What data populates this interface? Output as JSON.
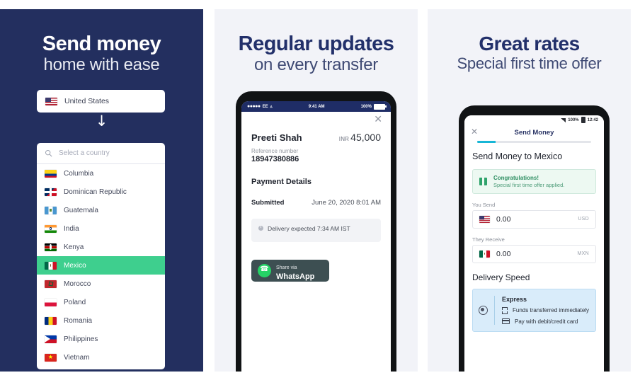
{
  "panels": {
    "left": {
      "headline_1": "Send money",
      "headline_2": "home with ease",
      "from_country": "United States",
      "search_placeholder": "Select a country",
      "countries": [
        {
          "name": "Columbia",
          "flag": "f-co",
          "selected": false
        },
        {
          "name": "Dominican Republic",
          "flag": "f-do",
          "selected": false
        },
        {
          "name": "Guatemala",
          "flag": "f-gt",
          "selected": false
        },
        {
          "name": "India",
          "flag": "f-in",
          "selected": false
        },
        {
          "name": "Kenya",
          "flag": "f-ke",
          "selected": false
        },
        {
          "name": "Mexico",
          "flag": "f-mx",
          "selected": true
        },
        {
          "name": "Morocco",
          "flag": "f-ma",
          "selected": false
        },
        {
          "name": "Poland",
          "flag": "f-pl",
          "selected": false
        },
        {
          "name": "Romania",
          "flag": "f-ro",
          "selected": false
        },
        {
          "name": "Philippines",
          "flag": "f-ph",
          "selected": false
        },
        {
          "name": "Vietnam",
          "flag": "f-vn",
          "selected": false
        }
      ]
    },
    "middle": {
      "headline_1": "Regular updates",
      "headline_2": "on every transfer",
      "statusbar": {
        "carrier": "EE",
        "time": "9:41 AM",
        "battery": "100%"
      },
      "recipient_name": "Preeti Shah",
      "amount_currency": "INR",
      "amount_value": "45,000",
      "reference_label": "Reference number",
      "reference_number": "18947380886",
      "section_title": "Payment Details",
      "submitted_label": "Submitted",
      "submitted_value": "June 20, 2020 8:01 AM",
      "delivery_note": "Delivery expected 7:34 AM IST",
      "share_line1": "Share via",
      "share_line2": "WhatsApp"
    },
    "right": {
      "headline_1": "Great rates",
      "headline_2": "Special first time offer",
      "statusbar": {
        "battery": "100%",
        "time": "12:42"
      },
      "tab_title": "Send Money",
      "page_title": "Send Money to Mexico",
      "congrats_title": "Congratulations!",
      "congrats_sub": "Special first time offer applied.",
      "you_send_label": "You Send",
      "you_send_value": "0.00",
      "you_send_currency": "USD",
      "they_receive_label": "They Receive",
      "they_receive_value": "0.00",
      "they_receive_currency": "MXN",
      "delivery_speed_label": "Delivery Speed",
      "speed_option_title": "Express",
      "speed_feature_1": "Funds transferred immediately",
      "speed_feature_2": "Pay with debit/credit card"
    }
  },
  "colors": {
    "navy": "#232f5f",
    "panel_bg": "#f2f3f8",
    "accent_green": "#3ecf8e",
    "progress_cyan": "#17b6d6",
    "whatsapp_green": "#25d366"
  }
}
